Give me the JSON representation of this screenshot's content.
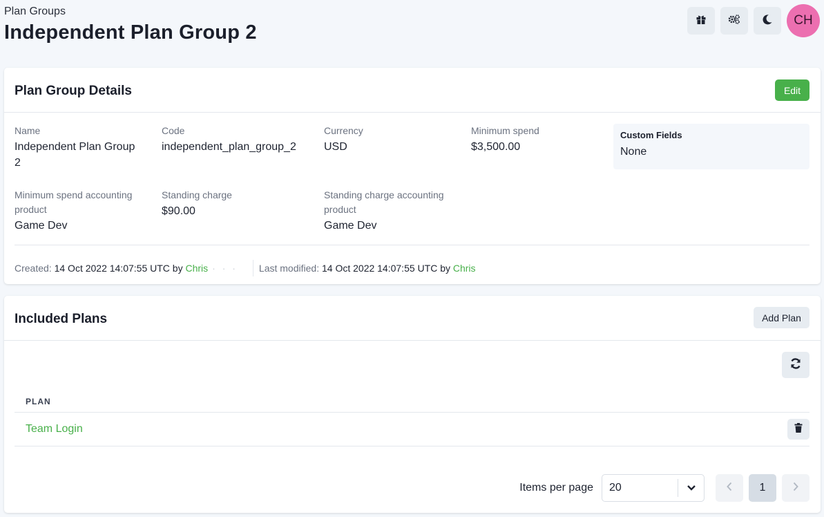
{
  "header": {
    "breadcrumb": "Plan Groups",
    "title": "Independent Plan Group 2",
    "avatar_initials": "CH",
    "icons": [
      "gift-icon",
      "settings-gears-icon",
      "moon-icon"
    ]
  },
  "details": {
    "title": "Plan Group Details",
    "edit_label": "Edit",
    "fields": {
      "name_label": "Name",
      "name_value_line1": "Independent Plan Group",
      "name_value_line2": "2",
      "code_label": "Code",
      "code_value": "independent_plan_group_2",
      "currency_label": "Currency",
      "currency_value": "USD",
      "min_spend_label": "Minimum spend",
      "min_spend_value": "$3,500.00",
      "min_spend_acct_label_line1": "Minimum spend accounting",
      "min_spend_acct_label_line2": "product",
      "min_spend_acct_value": "Game Dev",
      "standing_charge_label": "Standing charge",
      "standing_charge_value": "$90.00",
      "standing_acct_label_line1": "Standing charge accounting",
      "standing_acct_label_line2": "product",
      "standing_acct_value": "Game Dev"
    },
    "custom_fields": {
      "title": "Custom Fields",
      "value": "None"
    },
    "meta": {
      "created_label": "Created:",
      "created_value": "14 Oct 2022 14:07:55 UTC by",
      "created_by": "Chris",
      "modified_label": "Last modified:",
      "modified_value": "14 Oct 2022 14:07:55 UTC by",
      "modified_by": "Chris"
    }
  },
  "plans": {
    "title": "Included Plans",
    "add_label": "Add Plan",
    "column_header": "PLAN",
    "rows": [
      {
        "name": "Team Login"
      }
    ],
    "pagination": {
      "items_per_page_label": "Items per page",
      "items_per_page_value": "20",
      "current_page": "1"
    }
  },
  "colors": {
    "accent_green": "#48b04a",
    "avatar_pink": "#ec6fb0",
    "background": "#f4f7fb"
  }
}
